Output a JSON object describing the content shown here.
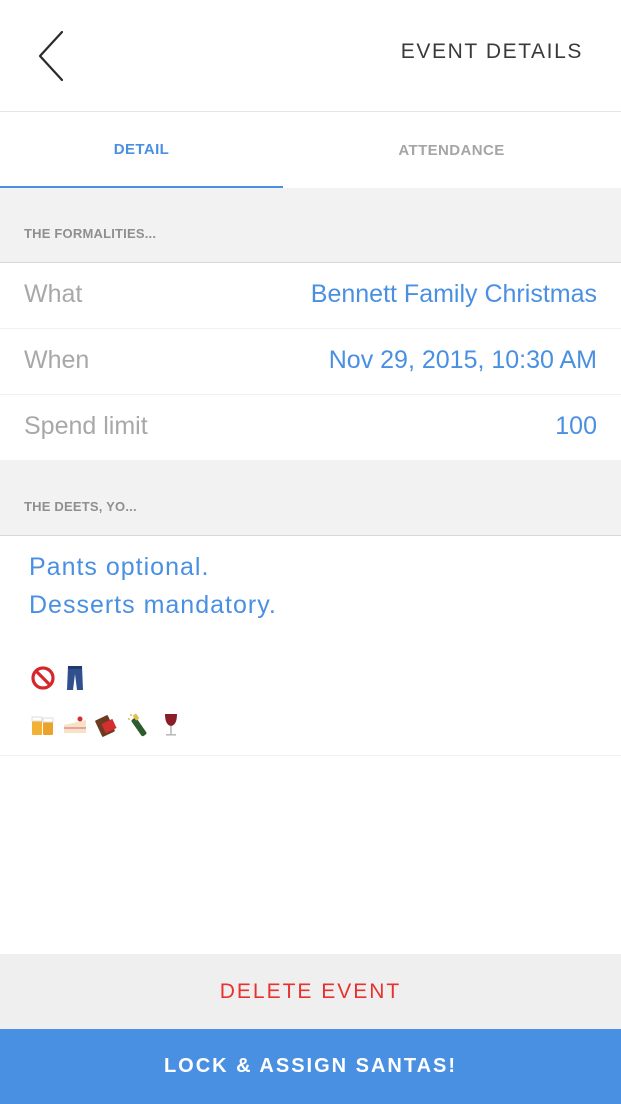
{
  "header": {
    "title": "EVENT DETAILS",
    "back_icon": "chevron-left-icon"
  },
  "tabs": [
    {
      "label": "DETAIL",
      "active": true
    },
    {
      "label": "ATTENDANCE",
      "active": false
    }
  ],
  "formalities": {
    "section_label": "THE FORMALITIES...",
    "rows": [
      {
        "label": "What",
        "value": "Bennett Family Christmas"
      },
      {
        "label": "When",
        "value": "Nov 29, 2015, 10:30 AM"
      },
      {
        "label": "Spend limit",
        "value": "100"
      }
    ]
  },
  "deets": {
    "section_label": "THE DEETS, YO...",
    "lines": [
      "Pants optional.",
      "Desserts mandatory."
    ],
    "emoji_row1": [
      "no-entry-icon",
      "jeans-icon"
    ],
    "emoji_row2": [
      "beer-mugs-icon",
      "cake-slice-icon",
      "chocolate-bar-icon",
      "champagne-icon",
      "wine-glass-icon"
    ]
  },
  "actions": {
    "delete_label": "DELETE EVENT",
    "lock_label": "LOCK & ASSIGN SANTAS!"
  },
  "colors": {
    "accent": "#4a90e2",
    "danger": "#e8322f",
    "muted": "#a8a8a8",
    "section_bg": "#f2f2f2"
  }
}
